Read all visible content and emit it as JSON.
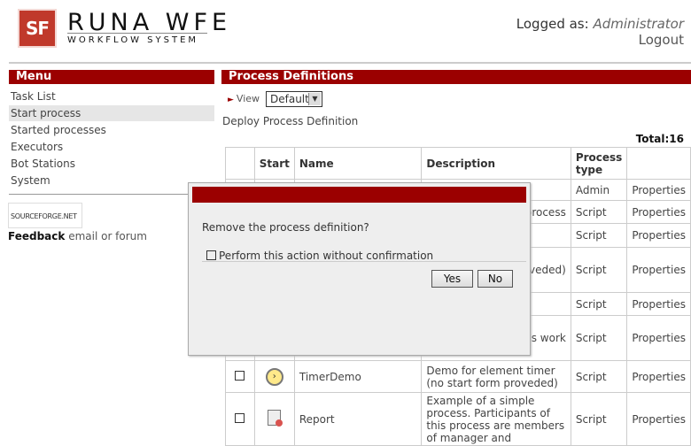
{
  "header": {
    "logo_mark": "SF",
    "logo_title": "RUNA WFE",
    "logo_subtitle": "WORKFLOW SYSTEM",
    "logged_label": "Logged as:",
    "logged_user": "Administrator",
    "logout": "Logout"
  },
  "menu": {
    "title": "Menu",
    "items": [
      "Task List",
      "Start process",
      "Started processes",
      "Executors",
      "Bot Stations",
      "System"
    ],
    "selected": "Start process",
    "sourceforge": "SOURCEFORGE.NET",
    "feedback_label": "Feedback",
    "feedback_rest": "email or forum"
  },
  "main": {
    "title": "Process Definitions",
    "view_label": "View",
    "view_value": "Default",
    "deploy_link": "Deploy Process Definition",
    "total": "Total:16",
    "columns": [
      "Start",
      "Name",
      "Description",
      "Process type"
    ],
    "rows": [
      {
        "name": "",
        "description": "",
        "type": "Admin",
        "props": "Properties"
      },
      {
        "name": "",
        "description": "process",
        "type": "Script",
        "props": "Properties"
      },
      {
        "name": "",
        "description": "",
        "type": "Script",
        "props": "Properties"
      },
      {
        "name": "",
        "description": "nHandler roveded)",
        "type": "Script",
        "props": "Properties"
      },
      {
        "name": "",
        "description": "",
        "type": "Script",
        "props": "Properties"
      },
      {
        "name": "",
        "description": "ow s work",
        "type": "Script",
        "props": "Properties"
      },
      {
        "name": "TimerDemo",
        "description": "Demo for element timer (no start form proveded)",
        "type": "Script",
        "props": "Properties"
      },
      {
        "name": "Report",
        "description": "Example of a simple process. Participants of this process are members of manager and",
        "type": "Script",
        "props": "Properties"
      }
    ]
  },
  "dialog": {
    "message": "Remove the process definition?",
    "checkbox_label": "Perform this action without confirmation",
    "yes": "Yes",
    "no": "No"
  },
  "colors": {
    "accent": "#9b0000"
  }
}
